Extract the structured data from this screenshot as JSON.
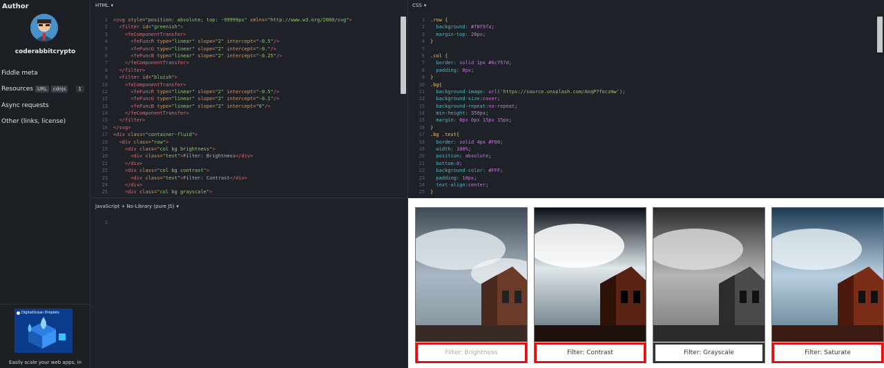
{
  "sidebar": {
    "heading": "Author",
    "username": "coderabbitcrypto",
    "items": [
      {
        "label": "Fiddle meta"
      },
      {
        "label": "Resources",
        "tags": [
          "URL",
          "cdnjs"
        ],
        "count": "1"
      },
      {
        "label": "Async requests"
      },
      {
        "label": "Other (links, license)"
      }
    ],
    "ad": {
      "title": "DigitalOcean Droplets",
      "text": "Easily scale your web apps, in"
    }
  },
  "html_panel": {
    "title": "HTML",
    "lines": [
      [
        [
          "tag",
          "<svg "
        ],
        [
          "attr",
          "style="
        ],
        [
          "str",
          "\"position: absolute; top: -99999px\""
        ],
        [
          "attr",
          " xmlns="
        ],
        [
          "str",
          "\"http://www.w3.org/2000/svg\""
        ],
        [
          "tag",
          ">"
        ]
      ],
      [
        [
          "tx",
          "  "
        ],
        [
          "tag",
          "<filter "
        ],
        [
          "attr",
          "id="
        ],
        [
          "str",
          "\"greenish\""
        ],
        [
          "tag",
          ">"
        ]
      ],
      [
        [
          "tx",
          "    "
        ],
        [
          "tag",
          "<feComponentTransfer>"
        ]
      ],
      [
        [
          "tx",
          "      "
        ],
        [
          "tag",
          "<feFuncR "
        ],
        [
          "attr",
          "type="
        ],
        [
          "str",
          "\"linear\""
        ],
        [
          "attr",
          " slope="
        ],
        [
          "str",
          "\"2\""
        ],
        [
          "attr",
          " intercept="
        ],
        [
          "str",
          "\"-0.5\""
        ],
        [
          "tag",
          "/>"
        ]
      ],
      [
        [
          "tx",
          "      "
        ],
        [
          "tag",
          "<feFuncG "
        ],
        [
          "attr",
          "type="
        ],
        [
          "str",
          "\"linear\""
        ],
        [
          "attr",
          " slope="
        ],
        [
          "str",
          "\"2\""
        ],
        [
          "attr",
          " intercept="
        ],
        [
          "str",
          "\"-0.\""
        ],
        [
          "tag",
          "/>"
        ]
      ],
      [
        [
          "tx",
          "      "
        ],
        [
          "tag",
          "<feFuncB "
        ],
        [
          "attr",
          "type="
        ],
        [
          "str",
          "\"linear\""
        ],
        [
          "attr",
          " slope="
        ],
        [
          "str",
          "\"2\""
        ],
        [
          "attr",
          " intercept="
        ],
        [
          "str",
          "\"-0.25\""
        ],
        [
          "tag",
          "/>"
        ]
      ],
      [
        [
          "tx",
          "    "
        ],
        [
          "tag",
          "</feComponentTransfer>"
        ]
      ],
      [
        [
          "tx",
          "  "
        ],
        [
          "tag",
          "</filter>"
        ]
      ],
      [
        [
          "tx",
          "  "
        ],
        [
          "tag",
          "<filter "
        ],
        [
          "attr",
          "id="
        ],
        [
          "str",
          "\"bluish\""
        ],
        [
          "tag",
          ">"
        ]
      ],
      [
        [
          "tx",
          "    "
        ],
        [
          "tag",
          "<feComponentTransfer>"
        ]
      ],
      [
        [
          "tx",
          "      "
        ],
        [
          "tag",
          "<feFuncR "
        ],
        [
          "attr",
          "type="
        ],
        [
          "str",
          "\"linear\""
        ],
        [
          "attr",
          " slope="
        ],
        [
          "str",
          "\"2\""
        ],
        [
          "attr",
          " intercept="
        ],
        [
          "str",
          "\"-0.5\""
        ],
        [
          "tag",
          "/>"
        ]
      ],
      [
        [
          "tx",
          "      "
        ],
        [
          "tag",
          "<feFuncG "
        ],
        [
          "attr",
          "type="
        ],
        [
          "str",
          "\"linear\""
        ],
        [
          "attr",
          " slope="
        ],
        [
          "str",
          "\"2\""
        ],
        [
          "attr",
          " intercept="
        ],
        [
          "str",
          "\"-0.1\""
        ],
        [
          "tag",
          "/>"
        ]
      ],
      [
        [
          "tx",
          "      "
        ],
        [
          "tag",
          "<feFuncB "
        ],
        [
          "attr",
          "type="
        ],
        [
          "str",
          "\"linear\""
        ],
        [
          "attr",
          " slope="
        ],
        [
          "str",
          "\"2\""
        ],
        [
          "attr",
          " intercept="
        ],
        [
          "str",
          "\"0\""
        ],
        [
          "tag",
          "/>"
        ]
      ],
      [
        [
          "tx",
          "    "
        ],
        [
          "tag",
          "</feComponentTransfer>"
        ]
      ],
      [
        [
          "tx",
          "  "
        ],
        [
          "tag",
          "</filter>"
        ]
      ],
      [
        [
          "tag",
          "</svg>"
        ]
      ],
      [
        [
          "tag",
          "<div "
        ],
        [
          "attr",
          "class="
        ],
        [
          "str",
          "\"container-fluid\""
        ],
        [
          "tag",
          ">"
        ]
      ],
      [
        [
          "tx",
          "  "
        ],
        [
          "tag",
          "<div "
        ],
        [
          "attr",
          "class="
        ],
        [
          "str",
          "\"row\""
        ],
        [
          "tag",
          ">"
        ]
      ],
      [
        [
          "tx",
          "    "
        ],
        [
          "tag",
          "<div "
        ],
        [
          "attr",
          "class="
        ],
        [
          "str",
          "\"col bg brightness\""
        ],
        [
          "tag",
          ">"
        ]
      ],
      [
        [
          "tx",
          "      "
        ],
        [
          "tag",
          "<div "
        ],
        [
          "attr",
          "class="
        ],
        [
          "str",
          "\"text\""
        ],
        [
          "tag",
          ">"
        ],
        [
          "tx",
          "Filter: Brightness"
        ],
        [
          "tag",
          "</div>"
        ]
      ],
      [
        [
          "tx",
          "    "
        ],
        [
          "tag",
          "</div>"
        ]
      ],
      [
        [
          "tx",
          "    "
        ],
        [
          "tag",
          "<div "
        ],
        [
          "attr",
          "class="
        ],
        [
          "str",
          "\"col bg contrast\""
        ],
        [
          "tag",
          ">"
        ]
      ],
      [
        [
          "tx",
          "      "
        ],
        [
          "tag",
          "<div "
        ],
        [
          "attr",
          "class="
        ],
        [
          "str",
          "\"text\""
        ],
        [
          "tag",
          ">"
        ],
        [
          "tx",
          "Filter: Contrast"
        ],
        [
          "tag",
          "</div>"
        ]
      ],
      [
        [
          "tx",
          "    "
        ],
        [
          "tag",
          "</div>"
        ]
      ],
      [
        [
          "tx",
          "    "
        ],
        [
          "tag",
          "<div "
        ],
        [
          "attr",
          "class="
        ],
        [
          "str",
          "\"col bg grayscale\""
        ],
        [
          "tag",
          ">"
        ]
      ]
    ]
  },
  "css_panel": {
    "title": "CSS",
    "lines": [
      [
        [
          "sel",
          ".row {"
        ]
      ],
      [
        [
          "prop",
          "  background: "
        ],
        [
          "val",
          "#f8f9fa"
        ],
        [
          "tx",
          ";"
        ]
      ],
      [
        [
          "prop",
          "  margin-top: "
        ],
        [
          "val",
          "20px"
        ],
        [
          "tx",
          ";"
        ]
      ],
      [
        [
          "sel",
          "}"
        ]
      ],
      [
        [
          "tx",
          ""
        ]
      ],
      [
        [
          "sel",
          ".col {"
        ]
      ],
      [
        [
          "prop",
          "  border: "
        ],
        [
          "val",
          "solid 1px #6c757d"
        ],
        [
          "tx",
          ";"
        ]
      ],
      [
        [
          "prop",
          "  padding: "
        ],
        [
          "val",
          "0px"
        ],
        [
          "tx",
          ";"
        ]
      ],
      [
        [
          "sel",
          "}"
        ]
      ],
      [
        [
          "sel",
          ".bg{"
        ]
      ],
      [
        [
          "prop",
          "  background-image: "
        ],
        [
          "val",
          "url"
        ],
        [
          "tx",
          "("
        ],
        [
          "str",
          "'https://source.unsplash.com/AnqP7foczmw'"
        ],
        [
          "tx",
          ");"
        ]
      ],
      [
        [
          "prop",
          "  background-size:"
        ],
        [
          "val",
          "cover"
        ],
        [
          "tx",
          ";"
        ]
      ],
      [
        [
          "prop",
          "  background-repeat:"
        ],
        [
          "val",
          "no-repeat"
        ],
        [
          "tx",
          ";"
        ]
      ],
      [
        [
          "prop",
          "  min-height: "
        ],
        [
          "val",
          "350px"
        ],
        [
          "tx",
          ";"
        ]
      ],
      [
        [
          "prop",
          "  margin: "
        ],
        [
          "val",
          "0px 0px 15px 15px"
        ],
        [
          "tx",
          ";"
        ]
      ],
      [
        [
          "sel",
          "}"
        ]
      ],
      [
        [
          "sel",
          ".bg .text{"
        ]
      ],
      [
        [
          "prop",
          "  border: "
        ],
        [
          "val",
          "solid 4px #F00"
        ],
        [
          "tx",
          ";"
        ]
      ],
      [
        [
          "prop",
          "  width: "
        ],
        [
          "val",
          "100%"
        ],
        [
          "tx",
          ";"
        ]
      ],
      [
        [
          "prop",
          "  position: "
        ],
        [
          "val",
          "absolute"
        ],
        [
          "tx",
          ";"
        ]
      ],
      [
        [
          "prop",
          "  bottom:"
        ],
        [
          "val",
          "0"
        ],
        [
          "tx",
          ";"
        ]
      ],
      [
        [
          "prop",
          "  background-color: "
        ],
        [
          "val",
          "#FFF"
        ],
        [
          "tx",
          ";"
        ]
      ],
      [
        [
          "prop",
          "  padding: "
        ],
        [
          "val",
          "10px"
        ],
        [
          "tx",
          ";"
        ]
      ],
      [
        [
          "prop",
          "  text-align:"
        ],
        [
          "val",
          "center"
        ],
        [
          "tx",
          ";"
        ]
      ],
      [
        [
          "sel",
          "}"
        ]
      ]
    ]
  },
  "js_panel": {
    "title": "JavaScript + No-Library (pure JS)",
    "lines": [
      [
        [
          "tx",
          ""
        ]
      ]
    ]
  },
  "result": {
    "cards": [
      {
        "caption": "Filter: Brightness"
      },
      {
        "caption": "Filter: Contrast"
      },
      {
        "caption": "Filter: Grayscale"
      },
      {
        "caption": "Filter: Saturate"
      }
    ]
  },
  "colors": {
    "editor_bg": "#1e2127",
    "caption_border": "#e01010"
  }
}
